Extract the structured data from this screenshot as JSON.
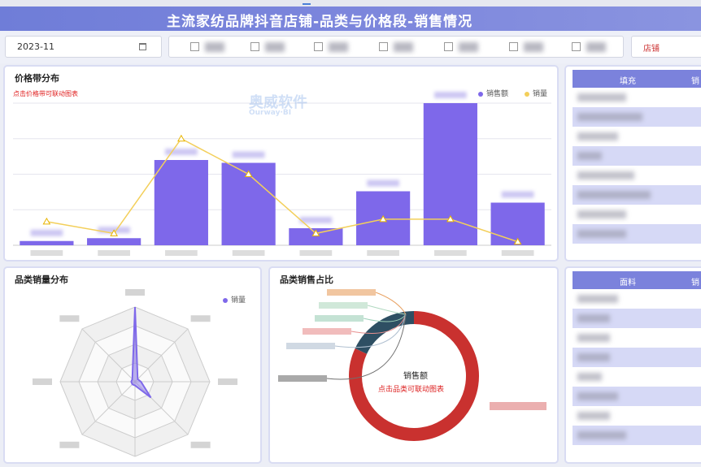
{
  "header": {
    "title": "主流家纺品牌抖音店铺-品类与价格段-销售情况"
  },
  "filters": {
    "date_value": "2023-11",
    "shop_label": "店铺"
  },
  "panels": {
    "price_band": {
      "title": "价格带分布",
      "hint": "点击价格带可联动图表",
      "legend_sales": "销售额",
      "legend_volume": "销量"
    },
    "category_volume": {
      "title": "品类销量分布",
      "legend_volume": "销量"
    },
    "category_share": {
      "title": "品类销售占比",
      "center_label": "销售额",
      "center_hint": "点击品类可联动图表"
    },
    "table_top": {
      "col1": "填充",
      "col2": "销"
    },
    "table_bottom": {
      "col1": "面料",
      "col2": "销"
    }
  },
  "watermark": {
    "cn": "奥威软件",
    "en": "Ourway·BI"
  },
  "colors": {
    "bar": "#7e68ea",
    "line": "#f3cf5a",
    "header": "#7b82dc",
    "donut_red": "#c9312f",
    "donut_dark": "#2e4f63"
  },
  "chart_data": [
    {
      "type": "bar",
      "title": "价格带分布",
      "series": [
        {
          "name": "销售额",
          "values": [
            3,
            5,
            60,
            58,
            12,
            38,
            100,
            30
          ]
        },
        {
          "name": "销量",
          "values": [
            20,
            10,
            90,
            60,
            10,
            22,
            22,
            3
          ]
        }
      ]
    },
    {
      "type": "radar",
      "title": "品类销量分布",
      "series": [
        {
          "name": "销量",
          "values": [
            100,
            5,
            8,
            30,
            5,
            5,
            5,
            5
          ]
        }
      ]
    },
    {
      "type": "pie",
      "title": "品类销售占比",
      "values": [
        82,
        18
      ]
    }
  ]
}
